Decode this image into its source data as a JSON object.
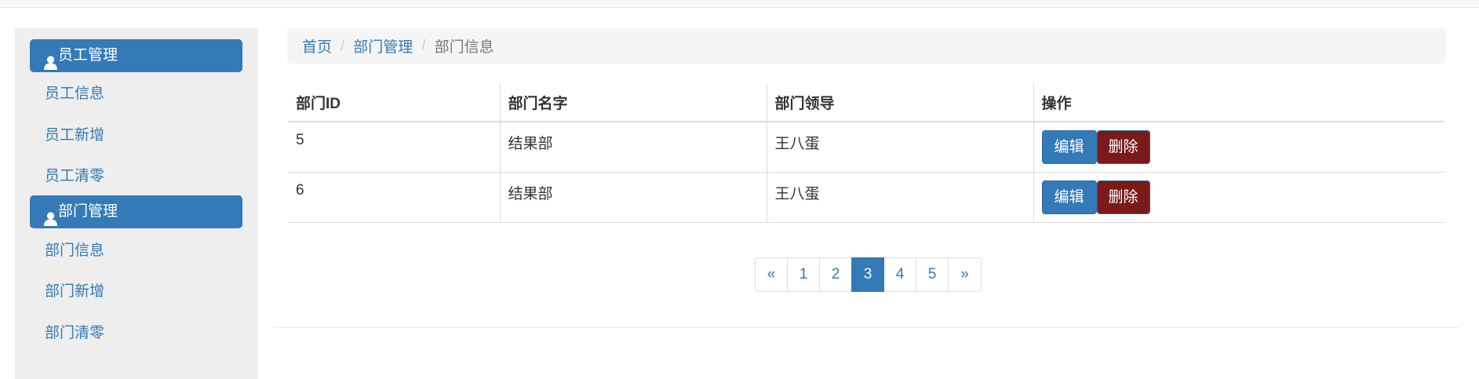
{
  "sidebar": {
    "sections": [
      {
        "heading": "员工管理",
        "icon": "user-icon",
        "items": [
          "员工信息",
          "员工新增",
          "员工清零"
        ]
      },
      {
        "heading": "部门管理",
        "icon": "user-icon",
        "items": [
          "部门信息",
          "部门新增",
          "部门清零"
        ]
      }
    ]
  },
  "breadcrumb": {
    "separator": "/",
    "items": [
      "首页",
      "部门管理",
      "部门信息"
    ]
  },
  "table": {
    "headers": [
      "部门ID",
      "部门名字",
      "部门领导",
      "操作"
    ],
    "rows": [
      {
        "id": "5",
        "name": "结果部",
        "leader": "王八蛋"
      },
      {
        "id": "6",
        "name": "结果部",
        "leader": "王八蛋"
      }
    ],
    "edit_label": "编辑",
    "delete_label": "删除"
  },
  "pagination": {
    "prev": "«",
    "pages": [
      "1",
      "2",
      "3",
      "4",
      "5"
    ],
    "next": "»",
    "active_page": "3"
  },
  "colors": {
    "primary": "#337ab7",
    "delete": "#7a1a1a",
    "sidebar_bg": "#eeeeee",
    "breadcrumb_bg": "#f5f5f5"
  }
}
